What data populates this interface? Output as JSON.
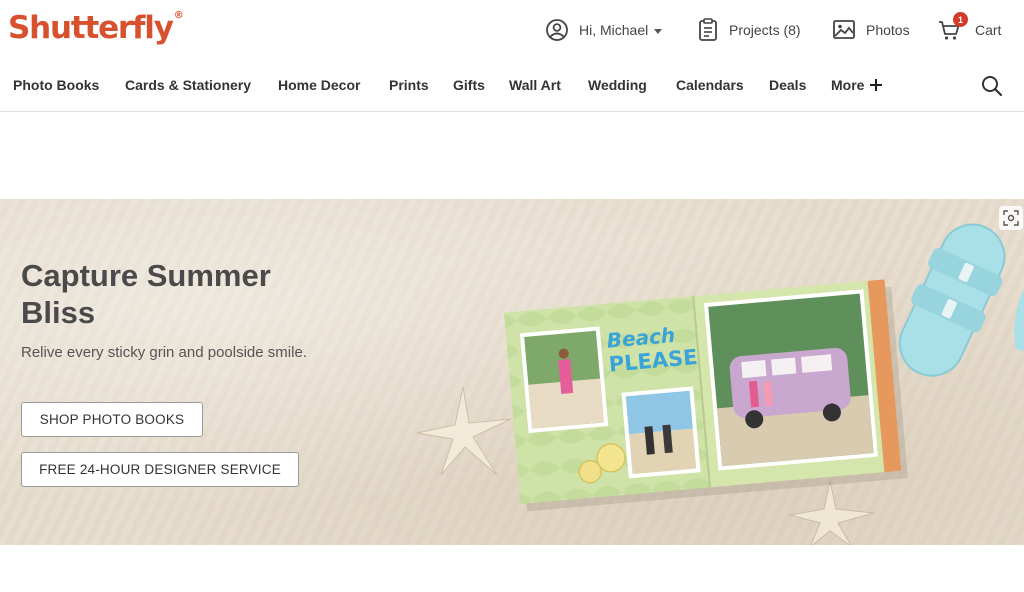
{
  "brand": {
    "name": "Shutterfly",
    "reg": "®",
    "color": "#d8512f"
  },
  "header": {
    "account": {
      "label": "Hi, Michael",
      "icon": "user-circle-icon"
    },
    "projects": {
      "label": "Projects (8)",
      "icon": "clipboard-icon"
    },
    "photos": {
      "label": "Photos",
      "icon": "image-icon"
    },
    "cart": {
      "label": "Cart",
      "badge": "1",
      "icon": "cart-icon",
      "badge_color": "#d33a2c"
    }
  },
  "nav": {
    "items": [
      "Photo Books",
      "Cards & Stationery",
      "Home Decor",
      "Prints",
      "Gifts",
      "Wall Art",
      "Wedding",
      "Calendars",
      "Deals"
    ],
    "more_label": "More",
    "search_icon": "search-icon"
  },
  "hero": {
    "title": "Capture Summer Bliss",
    "subtitle": "Relive every sticky grin and poolside smile.",
    "buttons": {
      "shop": "SHOP PHOTO BOOKS",
      "designer": "FREE 24-HOUR DESIGNER SERVICE"
    },
    "book_text_line1": "Beach",
    "book_text_line2": "PLEASE",
    "scan_icon": "visual-search-icon"
  }
}
